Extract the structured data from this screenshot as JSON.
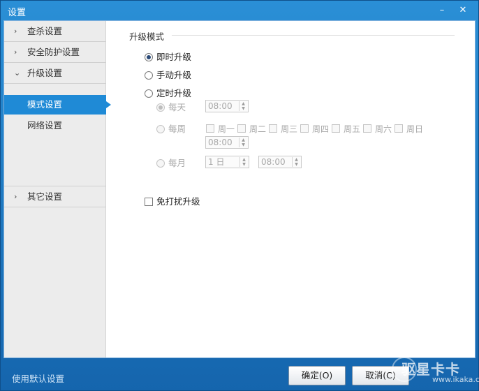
{
  "window": {
    "title": "设置",
    "minimize_glyph": "–",
    "close_glyph": "✕"
  },
  "sidebar": {
    "items": [
      {
        "label": "查杀设置",
        "chevron": "›"
      },
      {
        "label": "安全防护设置",
        "chevron": "›"
      },
      {
        "label": "升级设置",
        "chevron": "⌄"
      }
    ],
    "sub_items": [
      {
        "label": "模式设置",
        "active": true
      },
      {
        "label": "网络设置",
        "active": false
      }
    ],
    "other": {
      "label": "其它设置",
      "chevron": "›"
    }
  },
  "content": {
    "section_title": "升级模式",
    "options": {
      "instant": "即时升级",
      "manual": "手动升级",
      "scheduled": "定时升级"
    },
    "schedule": {
      "daily_label": "每天",
      "daily_time": "08:00",
      "weekly_label": "每周",
      "weekdays": [
        "周一",
        "周二",
        "周三",
        "周四",
        "周五",
        "周六",
        "周日"
      ],
      "weekly_time": "08:00",
      "monthly_label": "每月",
      "monthly_day": "1 日",
      "monthly_time": "08:00"
    },
    "no_disturb": "免打扰升级"
  },
  "footer": {
    "reset_label": "使用默认设置",
    "ok_label": "确定(O)",
    "cancel_label": "取消(C)"
  },
  "watermark": {
    "text": "驱星卡卡",
    "url": "www.ikaka.com"
  }
}
